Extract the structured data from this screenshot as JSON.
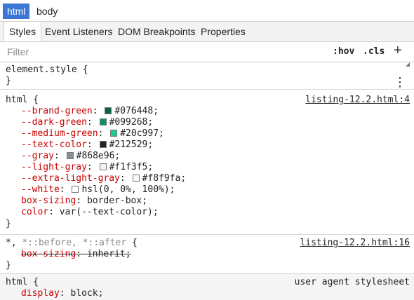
{
  "breadcrumb": [
    "html",
    "body"
  ],
  "tabs": [
    "Styles",
    "Event Listeners",
    "DOM Breakpoints",
    "Properties"
  ],
  "filter": {
    "placeholder": "Filter",
    "hov": ":hov",
    "cls": ".cls",
    "add": "+"
  },
  "element_style": {
    "selector": "element.style {",
    "close": "}"
  },
  "html_rule": {
    "selector": "html {",
    "source": "listing-12.2.html:4",
    "declarations": [
      {
        "prop": "--brand-green",
        "swatch": "#076448",
        "value": "#076448;"
      },
      {
        "prop": "--dark-green",
        "swatch": "#099268",
        "value": "#099268;"
      },
      {
        "prop": "--medium-green",
        "swatch": "#20c997",
        "value": "#20c997;"
      },
      {
        "prop": "--text-color",
        "swatch": "#212529",
        "value": "#212529;"
      },
      {
        "prop": "--gray",
        "swatch": "#868e96",
        "value": "#868e96;"
      },
      {
        "prop": "--light-gray",
        "swatch": "#f1f3f5",
        "value": "#f1f3f5;"
      },
      {
        "prop": "--extra-light-gray",
        "swatch": "#f8f9fa",
        "value": "#f8f9fa;"
      },
      {
        "prop": "--white",
        "swatch": "#ffffff",
        "value": "hsl(0, 0%, 100%);"
      },
      {
        "prop": "box-sizing",
        "value": "border-box;"
      },
      {
        "prop": "color",
        "value": "var(--text-color);"
      }
    ],
    "close": "}"
  },
  "universal_rule": {
    "sel_main": "*,",
    "sel_pseudo": "*::before, *::after",
    "brace": "{",
    "source": "listing-12.2.html:16",
    "decl_prop": "box-sizing",
    "decl_value": "inherit;",
    "close": "}"
  },
  "ua_rule": {
    "selector": "html {",
    "source": "user agent stylesheet",
    "decl_prop": "display",
    "decl_value": "block;"
  }
}
